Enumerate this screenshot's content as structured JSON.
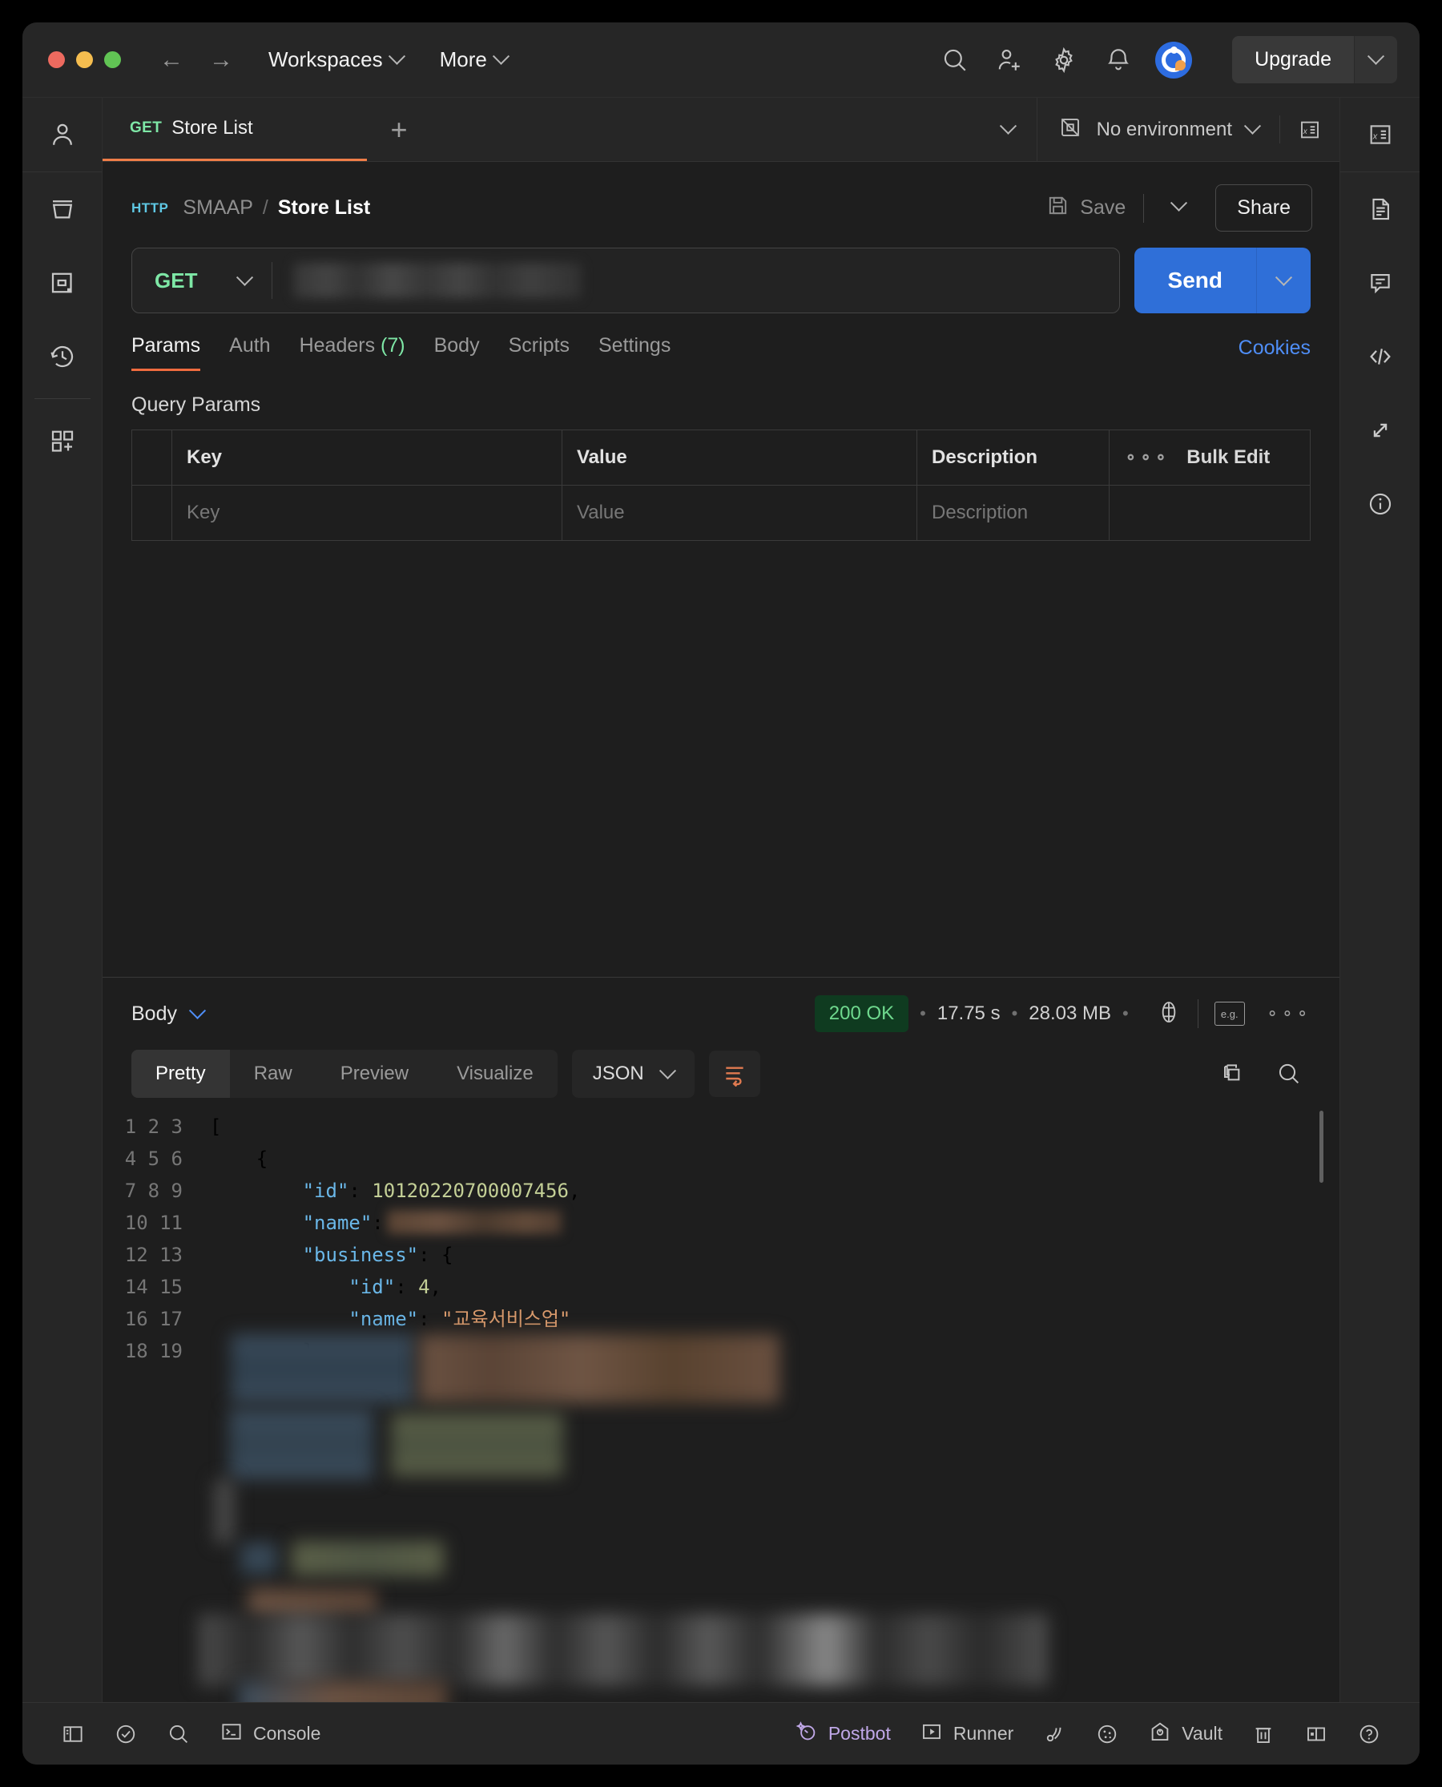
{
  "titlebar": {
    "workspaces_label": "Workspaces",
    "more_label": "More",
    "upgrade_label": "Upgrade",
    "icons": [
      "search-icon",
      "invite-user-icon",
      "gear-icon",
      "bell-icon",
      "avatar"
    ]
  },
  "tabstrip": {
    "tab": {
      "method": "GET",
      "name": "Store List"
    },
    "new_tab_label": "+",
    "environment_label": "No environment"
  },
  "breadcrumb": {
    "protocol_badge": "HTTP",
    "collection": "SMAAP",
    "separator": "/",
    "request": "Store List"
  },
  "actions": {
    "save_label": "Save",
    "share_label": "Share"
  },
  "url_bar": {
    "method": "GET",
    "url_value": "",
    "url_redacted": true,
    "send_label": "Send"
  },
  "request_tabs": [
    {
      "label": "Params",
      "count": "",
      "active": true
    },
    {
      "label": "Auth",
      "count": "",
      "active": false
    },
    {
      "label": "Headers",
      "count": "(7)",
      "active": false
    },
    {
      "label": "Body",
      "count": "",
      "active": false
    },
    {
      "label": "Scripts",
      "count": "",
      "active": false
    },
    {
      "label": "Settings",
      "count": "",
      "active": false
    }
  ],
  "cookies_label": "Cookies",
  "query_params": {
    "section_title": "Query Params",
    "headers": [
      "Key",
      "Value",
      "Description"
    ],
    "bulk_edit_label": "Bulk Edit",
    "placeholder_row": [
      "Key",
      "Value",
      "Description"
    ]
  },
  "response": {
    "body_label": "Body",
    "status": "200 OK",
    "time": "17.75 s",
    "size": "28.03 MB",
    "view_tabs": [
      "Pretty",
      "Raw",
      "Preview",
      "Visualize"
    ],
    "active_view_tab": "Pretty",
    "format": "JSON"
  },
  "json_lines": [
    {
      "n": "1",
      "html": "["
    },
    {
      "n": "2",
      "html": "    {"
    },
    {
      "n": "3",
      "html": "        <span class='k'>\"id\"</span>: <span class='num'>10120220700007456</span>,"
    },
    {
      "n": "4",
      "html": "        <span class='k'>\"name\"</span>:<span class='redact-inline'></span>"
    },
    {
      "n": "5",
      "html": "        <span class='k'>\"business\"</span>: {"
    },
    {
      "n": "6",
      "html": "            <span class='k'>\"id\"</span>: <span class='num'>4</span>,"
    },
    {
      "n": "7",
      "html": "            <span class='k'>\"name\"</span>: <span class='str'>\"교육서비스업\"</span>"
    },
    {
      "n": "8",
      "html": "        },"
    },
    {
      "n": "9",
      "html": ""
    },
    {
      "n": "10",
      "html": ""
    },
    {
      "n": "11",
      "html": ""
    },
    {
      "n": "12",
      "html": ""
    },
    {
      "n": "13",
      "html": ""
    },
    {
      "n": "14",
      "html": ""
    },
    {
      "n": "15",
      "html": ""
    },
    {
      "n": "16",
      "html": ""
    },
    {
      "n": "17",
      "html": ""
    },
    {
      "n": "18",
      "html": ""
    },
    {
      "n": "19",
      "html": ""
    }
  ],
  "statusbar": {
    "console_label": "Console",
    "postbot_label": "Postbot",
    "runner_label": "Runner",
    "vault_label": "Vault"
  },
  "colors": {
    "accent_orange": "#ef7d48",
    "method_green": "#7ee7a6",
    "send_blue": "#2f6fd8",
    "link_blue": "#4f8ef7",
    "status_green": "#6fd98e",
    "postbot_purple": "#c0a8e8"
  }
}
